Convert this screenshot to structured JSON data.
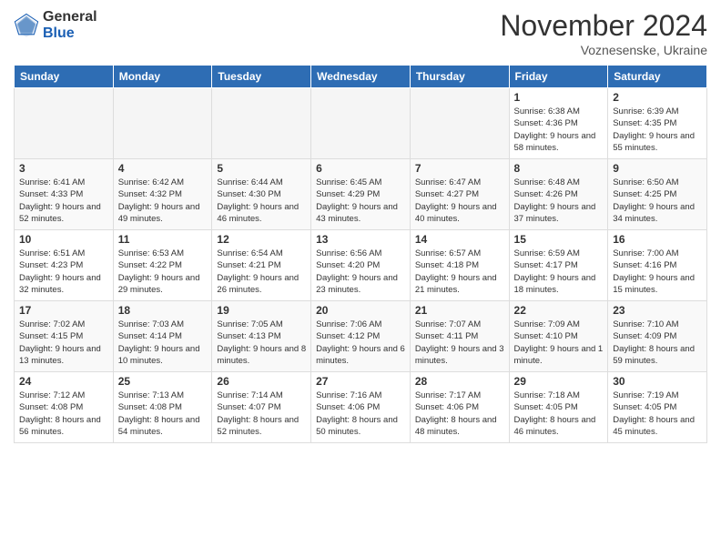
{
  "header": {
    "logo": {
      "general": "General",
      "blue": "Blue"
    },
    "title": "November 2024",
    "location": "Voznesenske, Ukraine"
  },
  "weekdays": [
    "Sunday",
    "Monday",
    "Tuesday",
    "Wednesday",
    "Thursday",
    "Friday",
    "Saturday"
  ],
  "weeks": [
    [
      {
        "day": "",
        "empty": true
      },
      {
        "day": "",
        "empty": true
      },
      {
        "day": "",
        "empty": true
      },
      {
        "day": "",
        "empty": true
      },
      {
        "day": "",
        "empty": true
      },
      {
        "day": "1",
        "sunrise": "6:38 AM",
        "sunset": "4:36 PM",
        "daylight": "9 hours and 58 minutes."
      },
      {
        "day": "2",
        "sunrise": "6:39 AM",
        "sunset": "4:35 PM",
        "daylight": "9 hours and 55 minutes."
      }
    ],
    [
      {
        "day": "3",
        "sunrise": "6:41 AM",
        "sunset": "4:33 PM",
        "daylight": "9 hours and 52 minutes."
      },
      {
        "day": "4",
        "sunrise": "6:42 AM",
        "sunset": "4:32 PM",
        "daylight": "9 hours and 49 minutes."
      },
      {
        "day": "5",
        "sunrise": "6:44 AM",
        "sunset": "4:30 PM",
        "daylight": "9 hours and 46 minutes."
      },
      {
        "day": "6",
        "sunrise": "6:45 AM",
        "sunset": "4:29 PM",
        "daylight": "9 hours and 43 minutes."
      },
      {
        "day": "7",
        "sunrise": "6:47 AM",
        "sunset": "4:27 PM",
        "daylight": "9 hours and 40 minutes."
      },
      {
        "day": "8",
        "sunrise": "6:48 AM",
        "sunset": "4:26 PM",
        "daylight": "9 hours and 37 minutes."
      },
      {
        "day": "9",
        "sunrise": "6:50 AM",
        "sunset": "4:25 PM",
        "daylight": "9 hours and 34 minutes."
      }
    ],
    [
      {
        "day": "10",
        "sunrise": "6:51 AM",
        "sunset": "4:23 PM",
        "daylight": "9 hours and 32 minutes."
      },
      {
        "day": "11",
        "sunrise": "6:53 AM",
        "sunset": "4:22 PM",
        "daylight": "9 hours and 29 minutes."
      },
      {
        "day": "12",
        "sunrise": "6:54 AM",
        "sunset": "4:21 PM",
        "daylight": "9 hours and 26 minutes."
      },
      {
        "day": "13",
        "sunrise": "6:56 AM",
        "sunset": "4:20 PM",
        "daylight": "9 hours and 23 minutes."
      },
      {
        "day": "14",
        "sunrise": "6:57 AM",
        "sunset": "4:18 PM",
        "daylight": "9 hours and 21 minutes."
      },
      {
        "day": "15",
        "sunrise": "6:59 AM",
        "sunset": "4:17 PM",
        "daylight": "9 hours and 18 minutes."
      },
      {
        "day": "16",
        "sunrise": "7:00 AM",
        "sunset": "4:16 PM",
        "daylight": "9 hours and 15 minutes."
      }
    ],
    [
      {
        "day": "17",
        "sunrise": "7:02 AM",
        "sunset": "4:15 PM",
        "daylight": "9 hours and 13 minutes."
      },
      {
        "day": "18",
        "sunrise": "7:03 AM",
        "sunset": "4:14 PM",
        "daylight": "9 hours and 10 minutes."
      },
      {
        "day": "19",
        "sunrise": "7:05 AM",
        "sunset": "4:13 PM",
        "daylight": "9 hours and 8 minutes."
      },
      {
        "day": "20",
        "sunrise": "7:06 AM",
        "sunset": "4:12 PM",
        "daylight": "9 hours and 6 minutes."
      },
      {
        "day": "21",
        "sunrise": "7:07 AM",
        "sunset": "4:11 PM",
        "daylight": "9 hours and 3 minutes."
      },
      {
        "day": "22",
        "sunrise": "7:09 AM",
        "sunset": "4:10 PM",
        "daylight": "9 hours and 1 minute."
      },
      {
        "day": "23",
        "sunrise": "7:10 AM",
        "sunset": "4:09 PM",
        "daylight": "8 hours and 59 minutes."
      }
    ],
    [
      {
        "day": "24",
        "sunrise": "7:12 AM",
        "sunset": "4:08 PM",
        "daylight": "8 hours and 56 minutes."
      },
      {
        "day": "25",
        "sunrise": "7:13 AM",
        "sunset": "4:08 PM",
        "daylight": "8 hours and 54 minutes."
      },
      {
        "day": "26",
        "sunrise": "7:14 AM",
        "sunset": "4:07 PM",
        "daylight": "8 hours and 52 minutes."
      },
      {
        "day": "27",
        "sunrise": "7:16 AM",
        "sunset": "4:06 PM",
        "daylight": "8 hours and 50 minutes."
      },
      {
        "day": "28",
        "sunrise": "7:17 AM",
        "sunset": "4:06 PM",
        "daylight": "8 hours and 48 minutes."
      },
      {
        "day": "29",
        "sunrise": "7:18 AM",
        "sunset": "4:05 PM",
        "daylight": "8 hours and 46 minutes."
      },
      {
        "day": "30",
        "sunrise": "7:19 AM",
        "sunset": "4:05 PM",
        "daylight": "8 hours and 45 minutes."
      }
    ]
  ]
}
